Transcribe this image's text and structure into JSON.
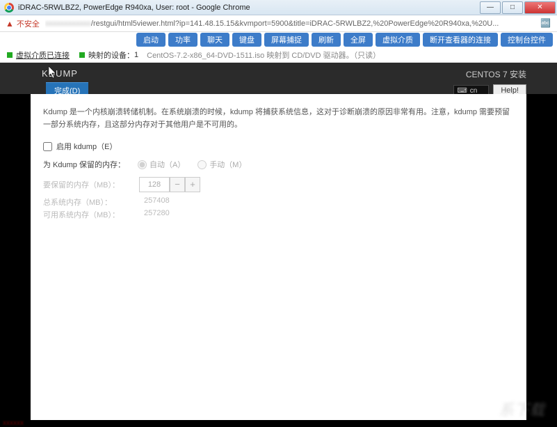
{
  "window": {
    "title": "iDRAC-5RWLBZ2, PowerEdge R940xa, User: root - Google Chrome"
  },
  "addressbar": {
    "insecure_label": "不安全",
    "url_blur": "xxxxxxxxxxxx",
    "url_rest": "/restgui/html5viewer.html?ip=141.48.15.15&kvmport=5900&title=iDRAC-5RWLBZ2,%20PowerEdge%20R940xa,%20U..."
  },
  "idrac_buttons": [
    "启动",
    "功率",
    "聊天",
    "键盘",
    "屏幕捕捉",
    "刷新",
    "全屏",
    "虚拟介质",
    "断开查看器的连接",
    "控制台控件"
  ],
  "status": {
    "vm_connected": "虚拟介质已连接",
    "mapped_label": "映射的设备：",
    "mapped_count": "1",
    "iso_text": "CentOS-7.2-x86_64-DVD-1511.iso 映射到 CD/DVD 驱动器。（只读）"
  },
  "installer": {
    "section_title": "KDUMP",
    "done_label": "完成(D)",
    "os_title": "CENTOS 7 安装",
    "keyboard_label": "cn",
    "help_label": "Help!",
    "description": "Kdump 是一个内核崩溃转储机制。在系统崩溃的时候，kdump 将捕获系统信息，这对于诊断崩溃的原因非常有用。注意，kdump 需要预留一部分系统内存，且这部分内存对于其他用户是不可用的。",
    "enable_kdump_label": "启用 kdump（E）",
    "reserve_label": "为 Kdump 保留的内存：",
    "auto_label": "自动（A）",
    "manual_label": "手动（M）",
    "mem_reserve_label": "要保留的内存（MB）：",
    "mem_reserve_value": "128",
    "total_mem_label": "总系统内存（MB）：",
    "total_mem_value": "257408",
    "avail_mem_label": "可用系统内存（MB）：",
    "avail_mem_value": "257280"
  }
}
